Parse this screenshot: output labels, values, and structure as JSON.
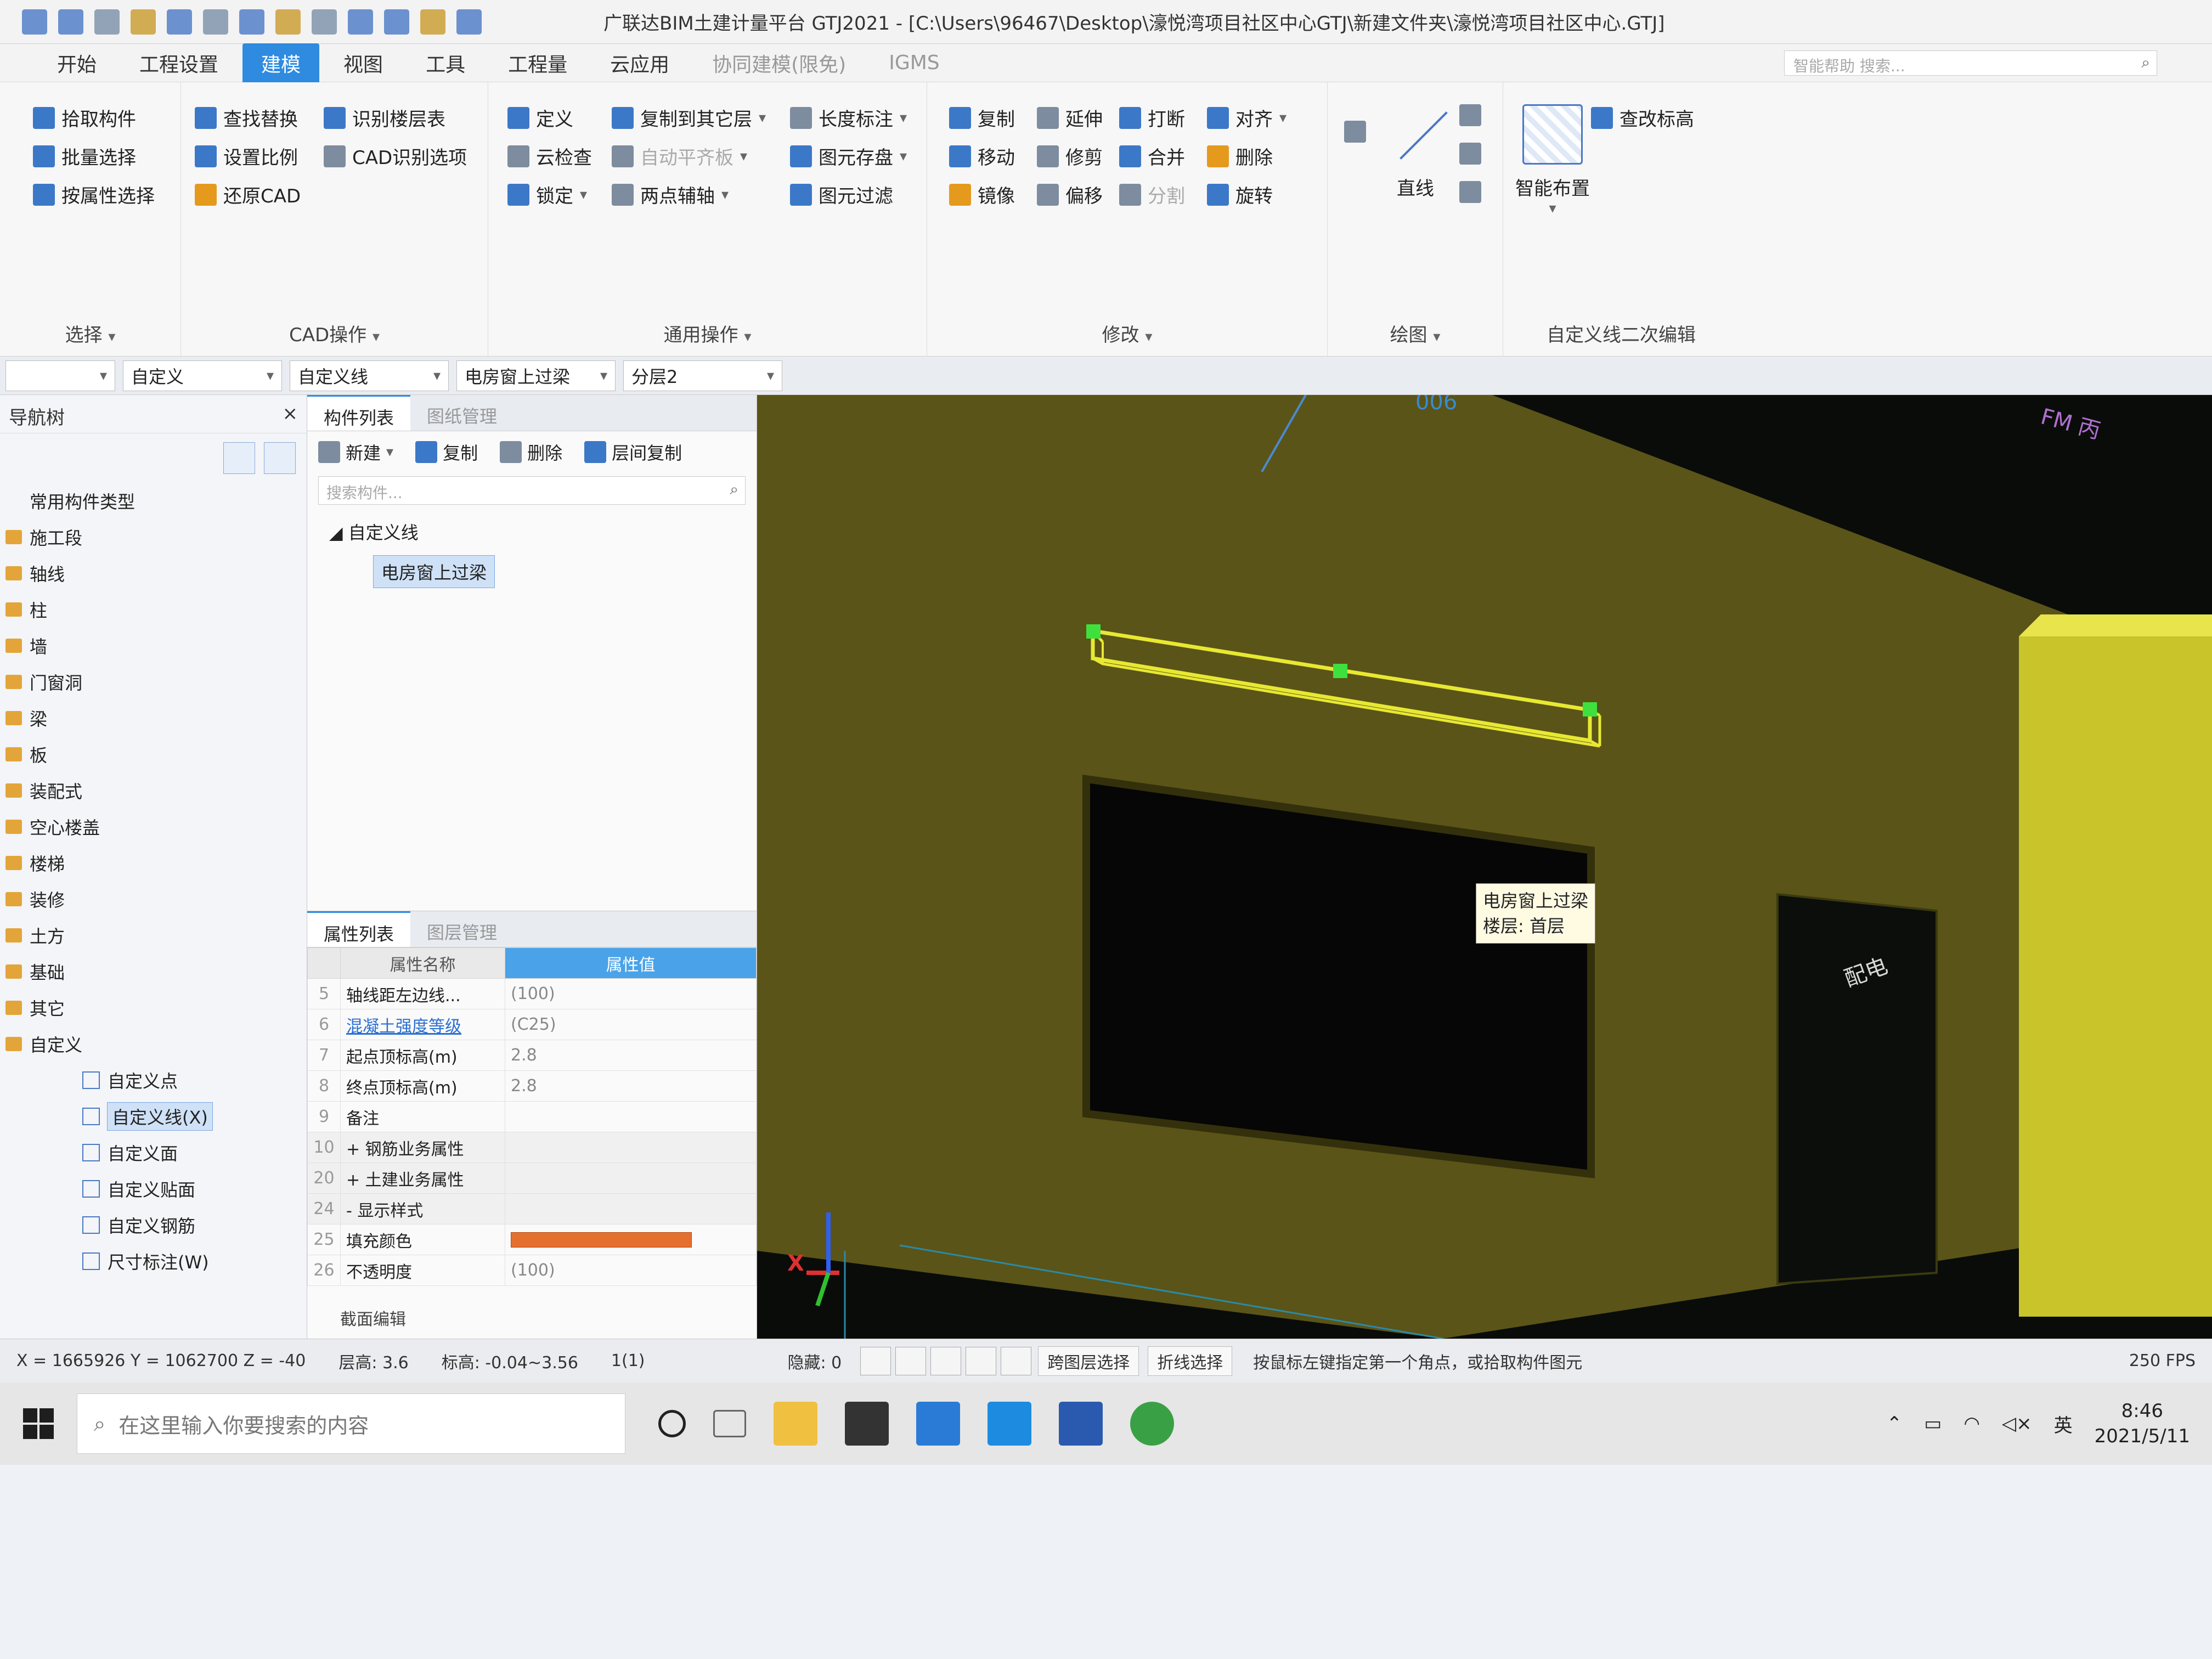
{
  "window": {
    "title": "广联达BIM土建计量平台 GTJ2021 - [C:\\Users\\96467\\Desktop\\濠悦湾项目社区中心GTJ\\新建文件夹\\濠悦湾项目社区中心.GTJ]"
  },
  "menu": {
    "tabs": [
      "开始",
      "工程设置",
      "建模",
      "视图",
      "工具",
      "工程量",
      "云应用",
      "协同建模(限免)",
      "IGMS"
    ],
    "active": "建模",
    "search_placeholder": "智能帮助  搜索..."
  },
  "ribbon": {
    "select": {
      "label": "选择",
      "items": [
        "拾取构件",
        "批量选择",
        "按属性选择"
      ]
    },
    "cad": {
      "label": "CAD操作",
      "items": [
        "查找替换",
        "识别楼层表",
        "设置比例",
        "CAD识别选项",
        "还原CAD"
      ]
    },
    "general": {
      "label": "通用操作",
      "items": [
        "定义",
        "复制到其它层",
        "长度标注",
        "云检查",
        "自动平齐板",
        "图元存盘",
        "锁定",
        "两点辅轴",
        "图元过滤"
      ]
    },
    "modify": {
      "label": "修改",
      "items": [
        "复制",
        "延伸",
        "打断",
        "对齐",
        "移动",
        "修剪",
        "合并",
        "删除",
        "镜像",
        "偏移",
        "分割",
        "旋转"
      ]
    },
    "draw": {
      "label": "绘图",
      "line_label": "直线"
    },
    "custom_line": {
      "label": "自定义线二次编辑",
      "smart_layout": "智能布置",
      "modify_elev": "查改标高"
    }
  },
  "filters": {
    "combo0": "",
    "combo1": "自定义",
    "combo2": "自定义线",
    "combo3": "电房窗上过梁",
    "combo4": "分层2"
  },
  "nav": {
    "title": "导航树",
    "items": [
      "常用构件类型",
      "施工段",
      "轴线",
      "柱",
      "墙",
      "门窗洞",
      "梁",
      "板",
      "装配式",
      "空心楼盖",
      "楼梯",
      "装修",
      "土方",
      "基础",
      "其它",
      "自定义"
    ],
    "sub_items": [
      "自定义点",
      "自定义线(X)",
      "自定义面",
      "自定义贴面",
      "自定义钢筋",
      "尺寸标注(W)"
    ],
    "selected": "自定义线(X)"
  },
  "component_list": {
    "tabs": [
      "构件列表",
      "图纸管理"
    ],
    "toolbar": {
      "new": "新建",
      "copy": "复制",
      "delete": "删除",
      "floor_copy": "层间复制"
    },
    "search_placeholder": "搜索构件...",
    "tree": {
      "group": "自定义线",
      "leaf": "电房窗上过梁"
    }
  },
  "properties": {
    "tabs": [
      "属性列表",
      "图层管理"
    ],
    "headers": {
      "name": "属性名称",
      "value": "属性值"
    },
    "rows": [
      {
        "num": "5",
        "name": "轴线距左边线...",
        "value": "(100)"
      },
      {
        "num": "6",
        "name": "混凝土强度等级",
        "value": "(C25)"
      },
      {
        "num": "7",
        "name": "起点顶标高(m)",
        "value": "2.8"
      },
      {
        "num": "8",
        "name": "终点顶标高(m)",
        "value": "2.8"
      },
      {
        "num": "9",
        "name": "备注",
        "value": ""
      },
      {
        "num": "10",
        "name": "+ 钢筋业务属性",
        "value": ""
      },
      {
        "num": "20",
        "name": "+ 土建业务属性",
        "value": ""
      },
      {
        "num": "24",
        "name": "- 显示样式",
        "value": ""
      },
      {
        "num": "25",
        "name": "填充颜色",
        "value": ""
      },
      {
        "num": "26",
        "name": "不透明度",
        "value": "(100)"
      }
    ],
    "fill_color": "#e5702e",
    "footer": "截面编辑"
  },
  "viewport": {
    "tooltip_name": "电房窗上过梁",
    "tooltip_floor": "楼层: 首层",
    "wall_color": "#5a5418",
    "beam_color": "#e8e832",
    "label_top": "006",
    "label_right": "FM 丙",
    "label_door": "配电",
    "axis_x": "X"
  },
  "status": {
    "coords": "X = 1665926 Y = 1062700 Z = -40",
    "floor_height": "层高: 3.6",
    "elevation": "标高: -0.04~3.56",
    "count": "1(1)",
    "hidden": "隐藏: 0",
    "cross_layer": "跨图层选择",
    "polyline": "折线选择",
    "hint": "按鼠标左键指定第一个角点，或拾取构件图元",
    "fps": "250 FPS"
  },
  "taskbar": {
    "search_placeholder": "在这里输入你要搜索的内容",
    "ime": "英",
    "time": "8:46",
    "date": "2021/5/11"
  }
}
